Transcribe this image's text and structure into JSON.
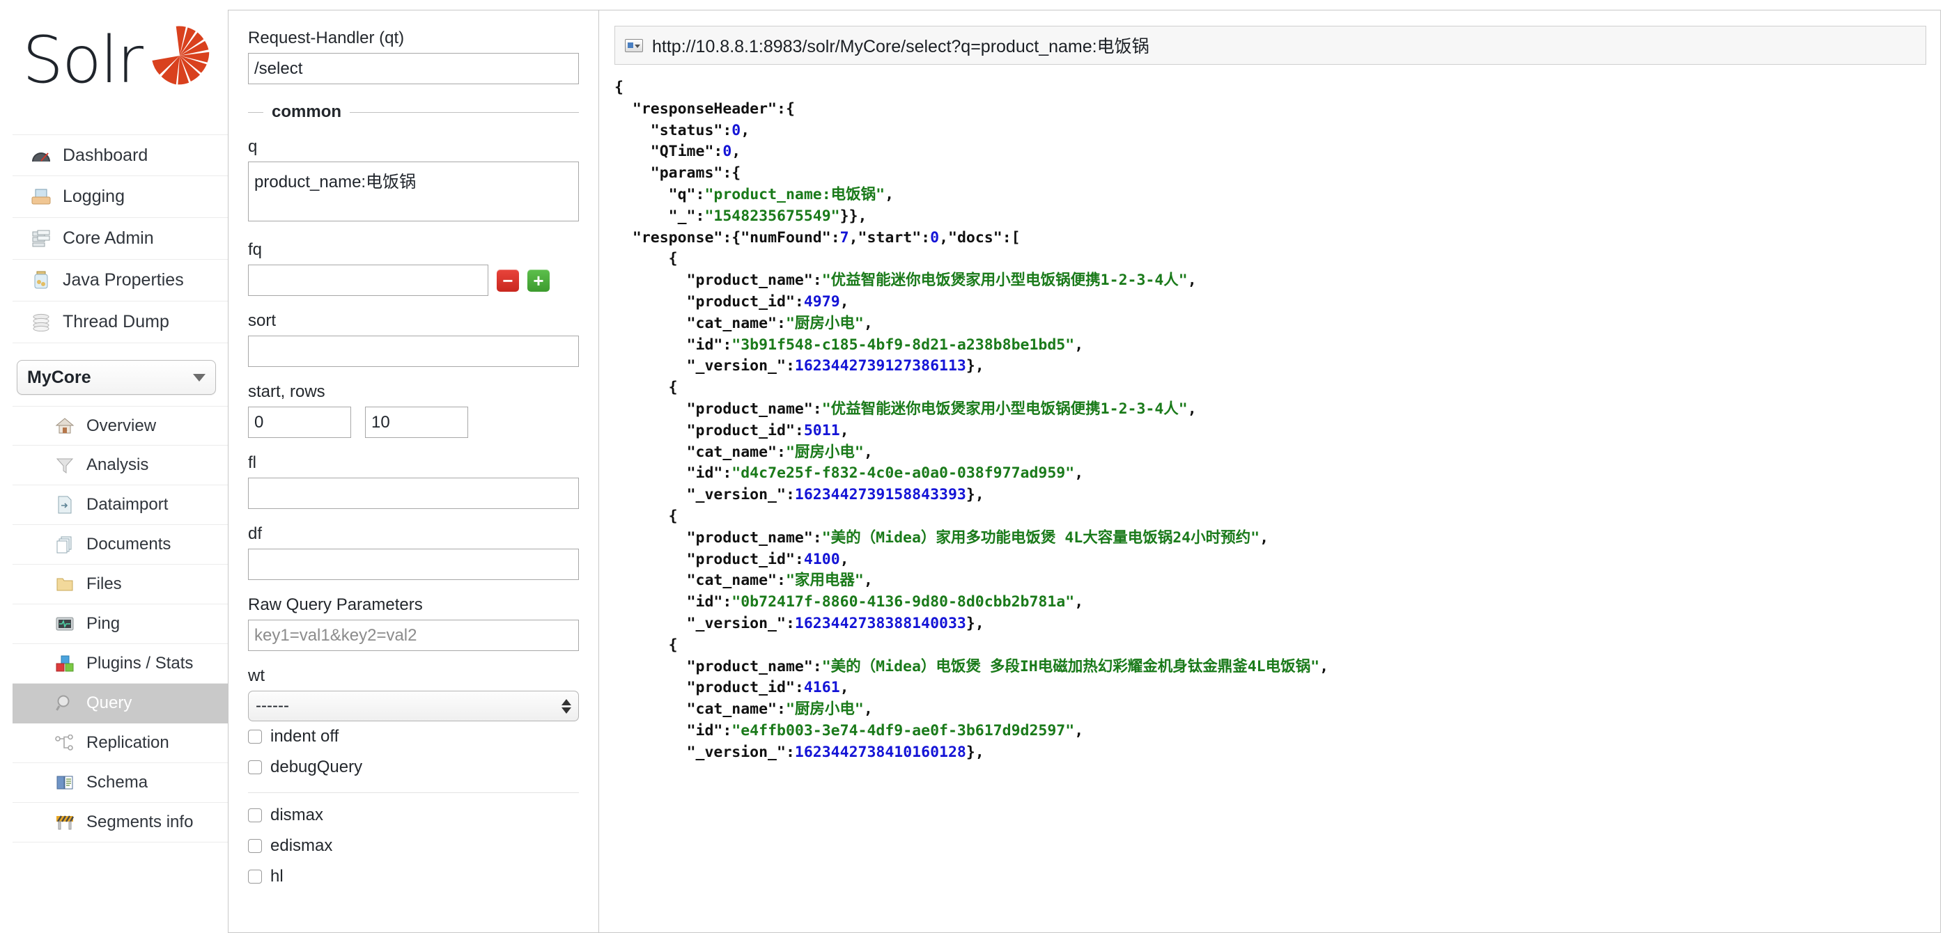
{
  "brand": {
    "name": "Solr",
    "logo_icon": "solr-sunburst-logo"
  },
  "sidebar": {
    "global_items": [
      {
        "label": "Dashboard",
        "icon": "dashboard-gauge-icon"
      },
      {
        "label": "Logging",
        "icon": "logging-tray-icon"
      },
      {
        "label": "Core Admin",
        "icon": "core-admin-servers-icon"
      },
      {
        "label": "Java Properties",
        "icon": "java-properties-jar-icon"
      },
      {
        "label": "Thread Dump",
        "icon": "thread-dump-stack-icon"
      }
    ],
    "core_selector": {
      "value": "MyCore",
      "icon": "chevron-down-icon"
    },
    "core_items": [
      {
        "label": "Overview",
        "icon": "home-icon",
        "active": false
      },
      {
        "label": "Analysis",
        "icon": "funnel-icon",
        "active": false
      },
      {
        "label": "Dataimport",
        "icon": "dataimport-page-icon",
        "active": false
      },
      {
        "label": "Documents",
        "icon": "documents-stack-icon",
        "active": false
      },
      {
        "label": "Files",
        "icon": "folder-icon",
        "active": false
      },
      {
        "label": "Ping",
        "icon": "ping-monitor-icon",
        "active": false
      },
      {
        "label": "Plugins / Stats",
        "icon": "plugins-blocks-icon",
        "active": false
      },
      {
        "label": "Query",
        "icon": "magnifier-icon",
        "active": true
      },
      {
        "label": "Replication",
        "icon": "replication-nodes-icon",
        "active": false
      },
      {
        "label": "Schema",
        "icon": "schema-book-icon",
        "active": false
      },
      {
        "label": "Segments info",
        "icon": "segments-barrier-icon",
        "active": false
      }
    ]
  },
  "query_form": {
    "request_handler": {
      "label": "Request-Handler (qt)",
      "value": "/select"
    },
    "common_legend": "common",
    "q": {
      "label": "q",
      "value": "product_name:电饭锅"
    },
    "fq": {
      "label": "fq",
      "value": "",
      "remove_icon": "minus-icon",
      "add_icon": "plus-icon"
    },
    "sort": {
      "label": "sort",
      "value": ""
    },
    "start_rows": {
      "label": "start, rows",
      "start": "0",
      "rows": "10"
    },
    "fl": {
      "label": "fl",
      "value": ""
    },
    "df": {
      "label": "df",
      "value": ""
    },
    "raw_query_parameters": {
      "label": "Raw Query Parameters",
      "value": "",
      "placeholder": "key1=val1&key2=val2"
    },
    "wt": {
      "label": "wt",
      "value": "------",
      "icon": "spinner-arrows-icon"
    },
    "checkboxes_primary": [
      {
        "label": "indent off",
        "checked": false
      },
      {
        "label": "debugQuery",
        "checked": false
      }
    ],
    "checkboxes_secondary": [
      {
        "label": "dismax",
        "checked": false
      },
      {
        "label": "edismax",
        "checked": false
      },
      {
        "label": "hl",
        "checked": false
      }
    ]
  },
  "result": {
    "url": "http://10.8.8.1:8983/solr/MyCore/select?q=product_name:电饭锅",
    "url_icon": "browser-window-icon",
    "response": {
      "responseHeader": {
        "status": 0,
        "QTime": 0,
        "params": {
          "q": "product_name:电饭锅",
          "_": "1548235675549"
        }
      },
      "numFound": 7,
      "start": 0,
      "docs": [
        {
          "product_name": "优益智能迷你电饭煲家用小型电饭锅便携1-2-3-4人",
          "product_id": 4979,
          "cat_name": "厨房小电",
          "id": "3b91f548-c185-4bf9-8d21-a238b8be1bd5",
          "_version_": "1623442739127386113"
        },
        {
          "product_name": "优益智能迷你电饭煲家用小型电饭锅便携1-2-3-4人",
          "product_id": 5011,
          "cat_name": "厨房小电",
          "id": "d4c7e25f-f832-4c0e-a0a0-038f977ad959",
          "_version_": "1623442739158843393"
        },
        {
          "product_name": "美的（Midea）家用多功能电饭煲 4L大容量电饭锅24小时预约",
          "product_id": 4100,
          "cat_name": "家用电器",
          "id": "0b72417f-8860-4136-9d80-8d0cbb2b781a",
          "_version_": "1623442738388140033"
        },
        {
          "product_name": "美的（Midea）电饭煲 多段IH电磁加热幻彩耀金机身钛金鼎釜4L电饭锅",
          "product_id": 4161,
          "cat_name": "厨房小电",
          "id": "e4ffb003-3e74-4df9-ae0f-3b617d9d2597",
          "_version_": "1623442738410160128"
        }
      ]
    }
  }
}
